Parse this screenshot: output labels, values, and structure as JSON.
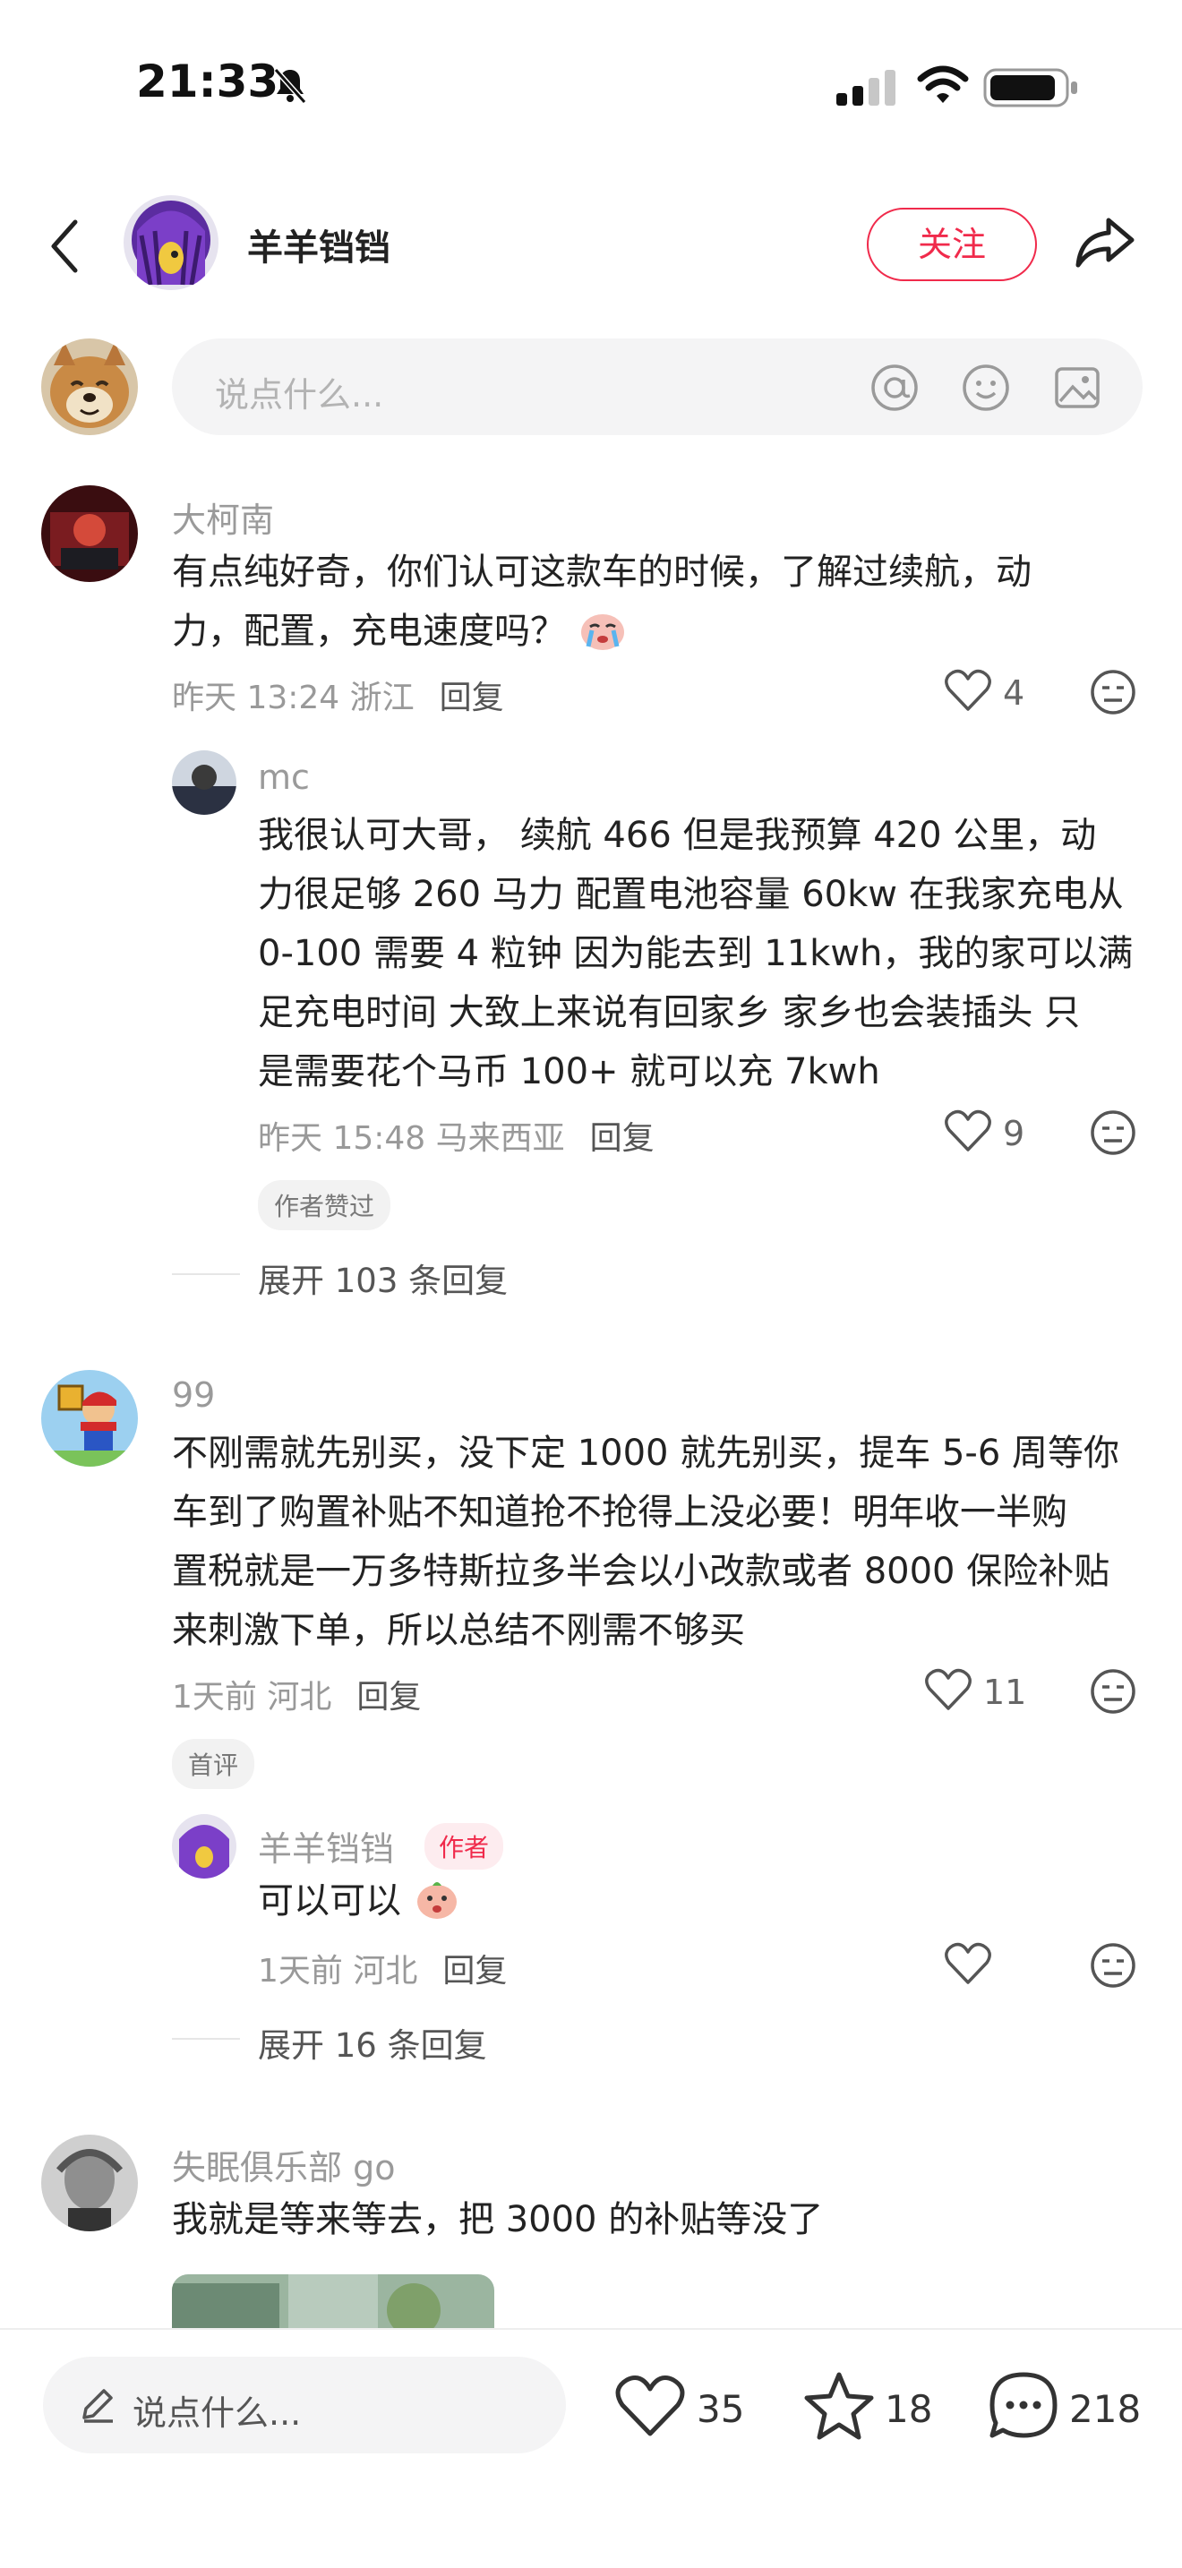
{
  "status": {
    "time": "21:33"
  },
  "header": {
    "author_name": "羊羊铛铛",
    "follow_label": "关注"
  },
  "composer": {
    "placeholder": "说点什么..."
  },
  "comments": [
    {
      "user": "大柯南",
      "text_line1": "有点纯好奇，你们认可这款车的时候，了解过续航，动",
      "text_line2": "力，配置，充电速度吗？",
      "time": "昨天 13:24 浙江",
      "reply": "回复",
      "likes": "4",
      "replies": [
        {
          "user": "mc",
          "lines": [
            "我很认可大哥， 续航 466 但是我预算 420 公里，动",
            "力很足够 260 马力 配置电池容量 60kw 在我家充电从",
            "0-100 需要 4 粒钟 因为能去到 11kwh，我的家可以满",
            "足充电时间 大致上来说有回家乡 家乡也会装插头 只",
            "是需要花个马币 100+ 就可以充 7kwh"
          ],
          "time": "昨天 15:48 马来西亚",
          "reply": "回复",
          "likes": "9",
          "tag": "作者赞过"
        }
      ],
      "expand": "展开 103 条回复"
    },
    {
      "user": "99",
      "lines": [
        "不刚需就先别买，没下定 1000 就先别买，提车 5-6 周等你",
        "车到了购置补贴不知道抢不抢得上没必要！明年收一半购",
        "置税就是一万多特斯拉多半会以小改款或者 8000 保险补贴",
        "来刺激下单，所以总结不刚需不够买"
      ],
      "time": "1天前 河北",
      "reply": "回复",
      "likes": "11",
      "tag": "首评",
      "replies": [
        {
          "user": "羊羊铛铛",
          "author_tag": "作者",
          "text": "可以可以",
          "time": "1天前 河北",
          "reply": "回复"
        }
      ],
      "expand": "展开 16 条回复"
    },
    {
      "user": "失眠俱乐部 go",
      "text": "我就是等来等去，把 3000 的补贴等没了"
    }
  ],
  "bottom_bar": {
    "placeholder": "说点什么...",
    "likes": "35",
    "stars": "18",
    "comments": "218"
  },
  "colors": {
    "accent": "#f02a4b",
    "muted": "#999999"
  }
}
